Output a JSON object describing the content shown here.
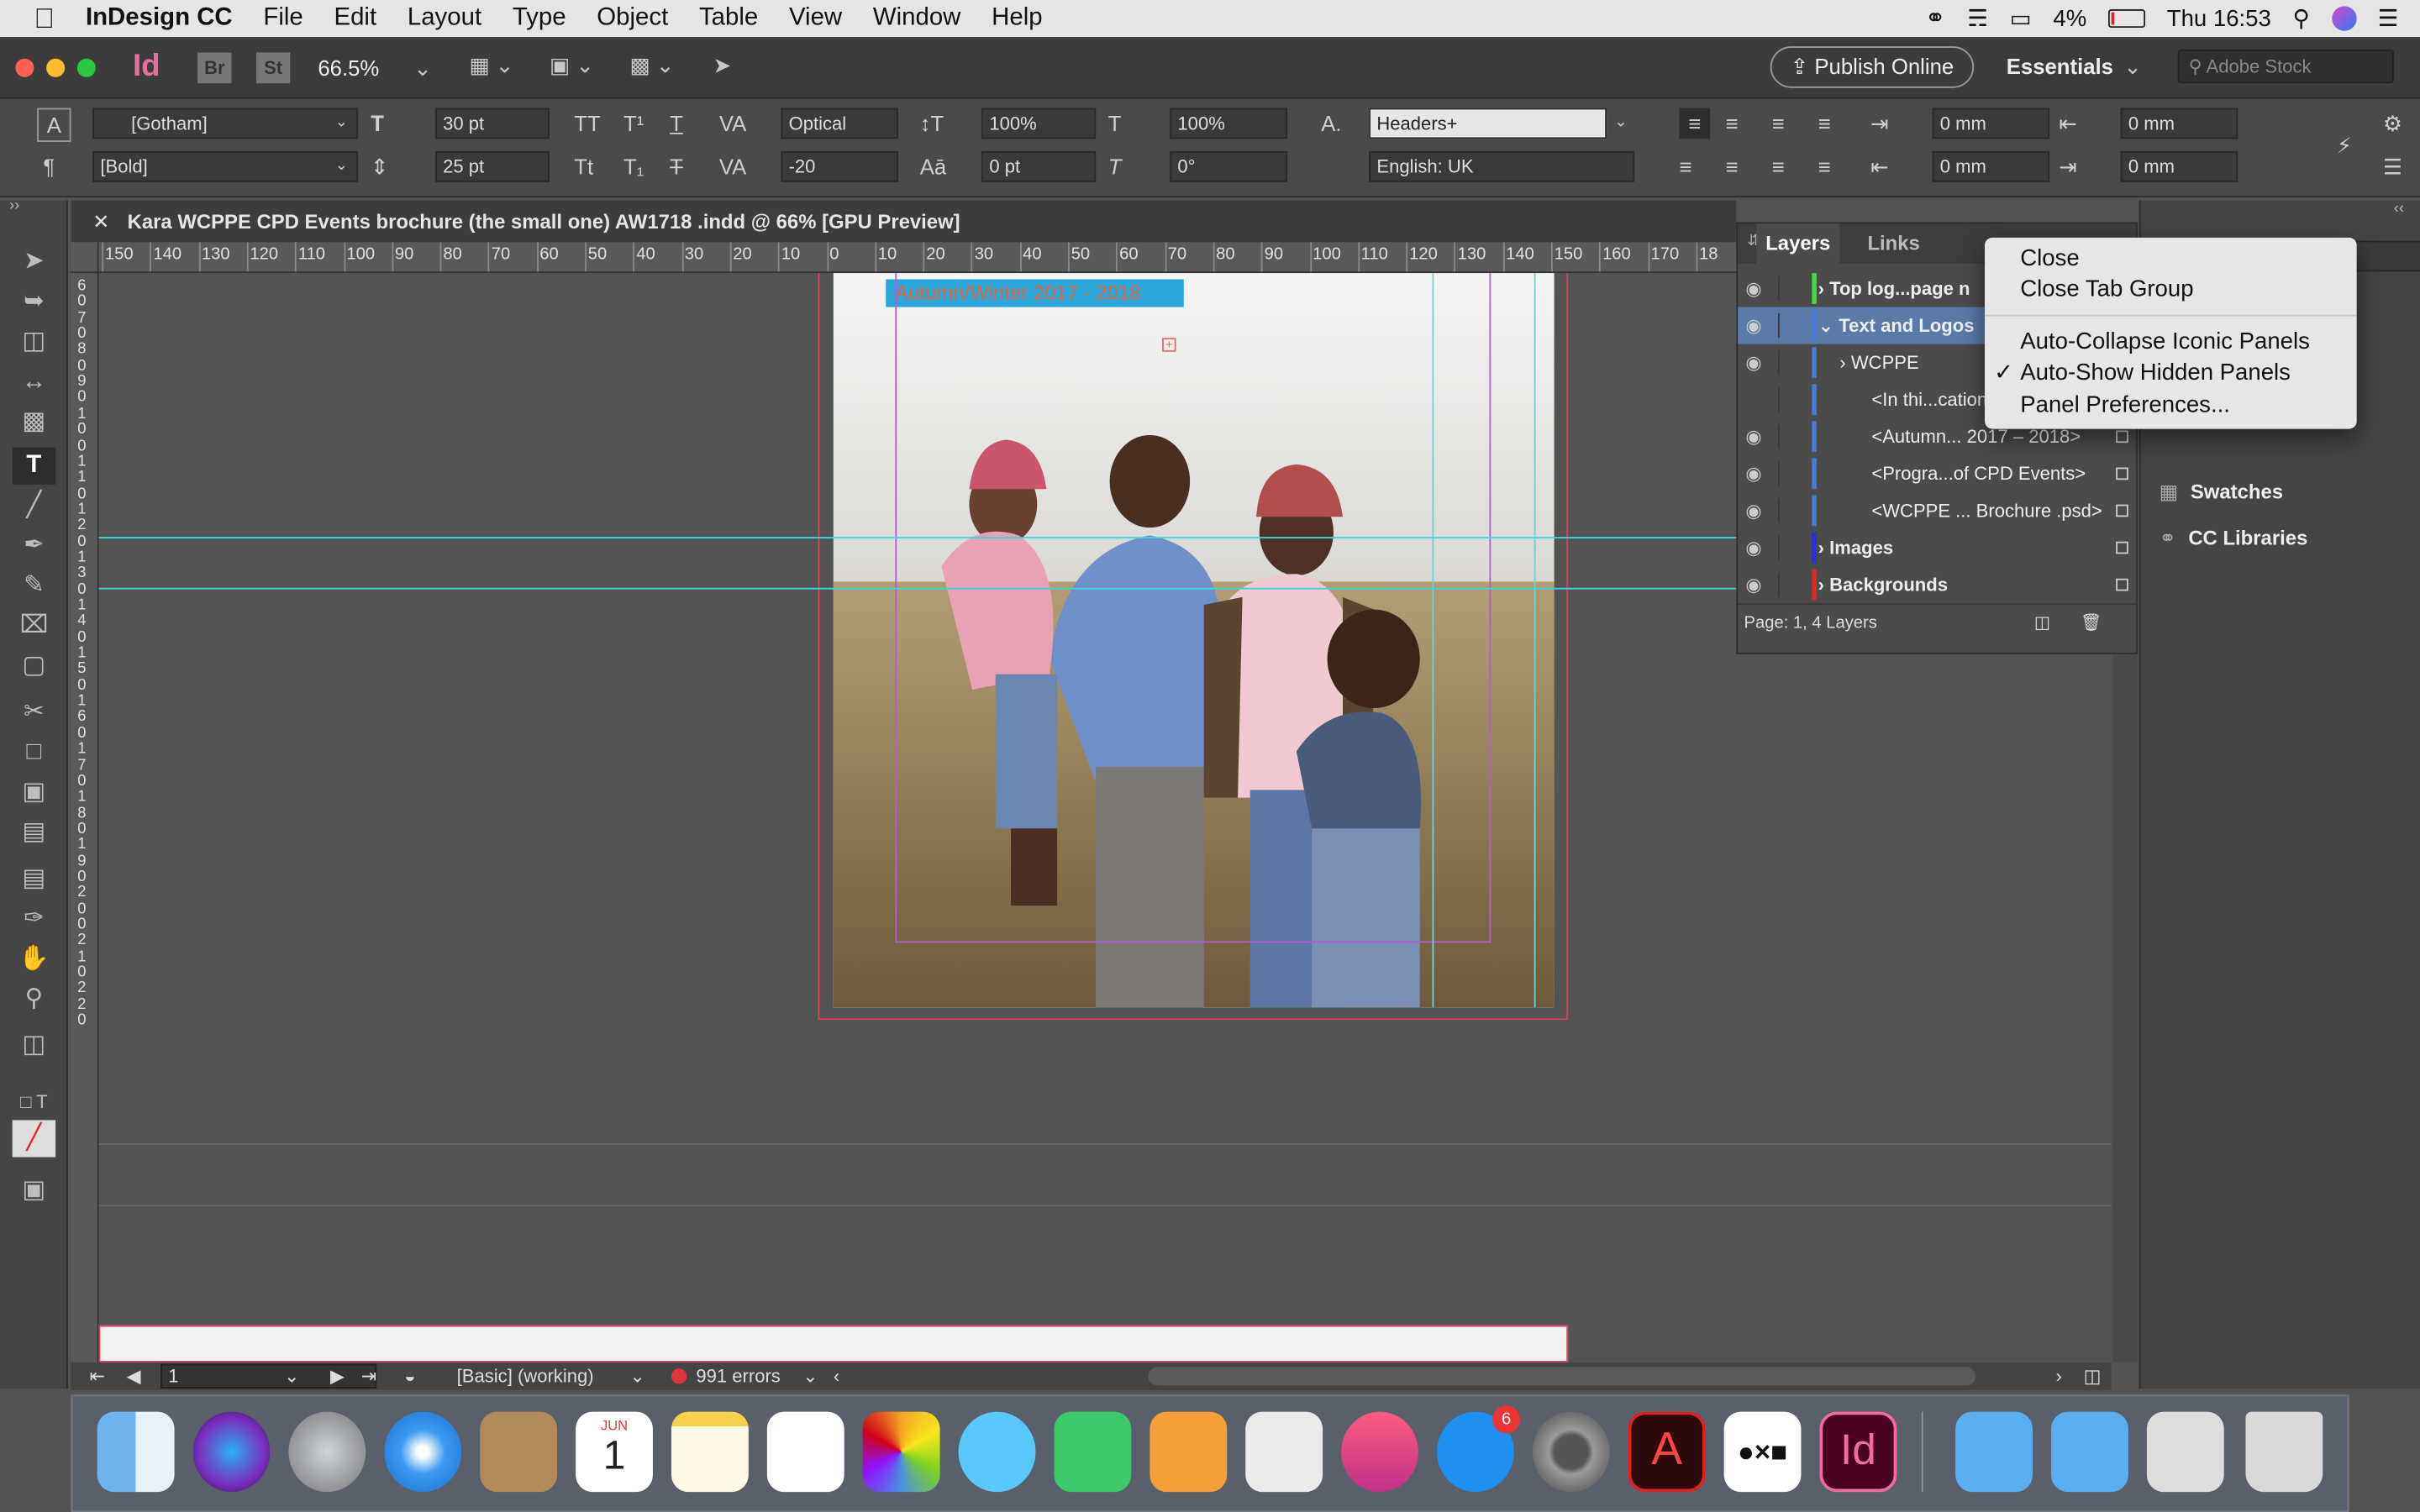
{
  "menubar": {
    "app_name": "InDesign CC",
    "items": [
      "File",
      "Edit",
      "Layout",
      "Type",
      "Object",
      "Table",
      "View",
      "Window",
      "Help"
    ],
    "battery": "4%",
    "clock": "Thu 16:53"
  },
  "appbar": {
    "zoom": "66.5%",
    "publish_label": "Publish Online",
    "workspace": "Essentials",
    "stock_placeholder": "Adobe Stock",
    "bridge_label": "Br",
    "stock_label": "St",
    "app_icon": "Id"
  },
  "control": {
    "font_family": "[Gotham]",
    "font_style": "[Bold]",
    "font_size": "30 pt",
    "leading": "25 pt",
    "kerning": "Optical",
    "tracking": "-20",
    "vscale": "100%",
    "hscale": "100%",
    "baseline": "0 pt",
    "skew": "0°",
    "para_style": "Headers+",
    "language": "English: UK",
    "indent_left": "0 mm",
    "indent_right": "0 mm",
    "space_before": "0 mm",
    "space_after": "0 mm"
  },
  "document": {
    "tab_title": "Kara WCPPE CPD Events brochure (the small one) AW1718 .indd @ 66% [GPU Preview]",
    "headline": "Autumn/Winter 2017 - 2018"
  },
  "ruler": {
    "h_ticks": [
      "150",
      "140",
      "130",
      "120",
      "110",
      "100",
      "90",
      "80",
      "70",
      "60",
      "50",
      "40",
      "30",
      "20",
      "10",
      "0",
      "10",
      "20",
      "30",
      "40",
      "50",
      "60",
      "70",
      "80",
      "90",
      "100",
      "110",
      "120",
      "130",
      "140",
      "150",
      "160",
      "170",
      "18"
    ],
    "v_numbers": [
      "6",
      "0",
      "7",
      "0",
      "8",
      "0",
      "9",
      "0",
      "1",
      "0",
      "0",
      "1",
      "1",
      "0",
      "1",
      "2",
      "0",
      "1",
      "3",
      "0",
      "1",
      "4",
      "0",
      "1",
      "5",
      "0",
      "1",
      "6",
      "0",
      "1",
      "7",
      "0",
      "1",
      "8",
      "0",
      "1",
      "9",
      "0",
      "2",
      "0",
      "0",
      "2",
      "1",
      "0",
      "2",
      "2",
      "0"
    ]
  },
  "status": {
    "page": "1",
    "preflight_profile": "[Basic] (working)",
    "errors": "991 errors"
  },
  "layers_panel": {
    "tabs": [
      "Layers",
      "Links"
    ],
    "rows": [
      {
        "name": "Top log...page n",
        "indent": 1,
        "expander": ">",
        "color": "#48d84b",
        "eye": true
      },
      {
        "name": "Text and Logos",
        "indent": 1,
        "expander": "v",
        "color": "#4a7ad8",
        "eye": true,
        "selected": true
      },
      {
        "name": "WCPPE",
        "indent": 2,
        "expander": ">",
        "color": "#4a7ad8",
        "eye": true
      },
      {
        "name": "<In thi...cation",
        "indent": 3,
        "expander": "",
        "color": "#4a7ad8",
        "eye": false
      },
      {
        "name": "<Autumn... 2017 – 2018>",
        "indent": 3,
        "expander": "",
        "color": "#4a7ad8",
        "eye": true
      },
      {
        "name": "<Progra...of CPD Events>",
        "indent": 3,
        "expander": "",
        "color": "#4a7ad8",
        "eye": true
      },
      {
        "name": "<WCPPE ... Brochure .psd>",
        "indent": 3,
        "expander": "",
        "color": "#4a7ad8",
        "eye": true
      },
      {
        "name": "Images",
        "indent": 1,
        "expander": ">",
        "color": "#2d2fd8",
        "eye": true
      },
      {
        "name": "Backgrounds",
        "indent": 1,
        "expander": ">",
        "color": "#d82b2b",
        "eye": true
      }
    ],
    "footer": "Page: 1, 4 Layers"
  },
  "context_menu": {
    "items": [
      "Close",
      "Close Tab Group",
      "Auto-Collapse Iconic Panels",
      "Auto-Show Hidden Panels",
      "Panel Preferences..."
    ],
    "checked": "Auto-Show Hidden Panels"
  },
  "right_dock": {
    "items": [
      "Swatches",
      "CC Libraries"
    ]
  },
  "dock": {
    "appstore_badge": "6",
    "calendar_month": "JUN",
    "calendar_day": "1"
  }
}
